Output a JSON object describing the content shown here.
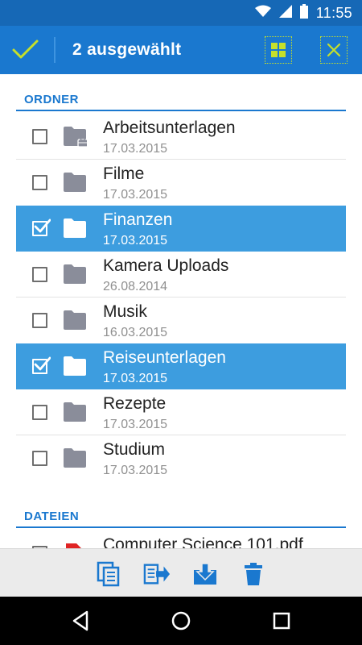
{
  "status_bar": {
    "time": "11:55"
  },
  "action_bar": {
    "title": "2 ausgewählt"
  },
  "sections": {
    "folders": "ORDNER",
    "files": "DATEIEN"
  },
  "folders": [
    {
      "name": "Arbeitsunterlagen",
      "date": "17.03.2015",
      "checked": false,
      "shared": true
    },
    {
      "name": "Filme",
      "date": "17.03.2015",
      "checked": false,
      "shared": false
    },
    {
      "name": "Finanzen",
      "date": "17.03.2015",
      "checked": true,
      "shared": false
    },
    {
      "name": "Kamera Uploads",
      "date": "26.08.2014",
      "checked": false,
      "shared": false
    },
    {
      "name": "Musik",
      "date": "16.03.2015",
      "checked": false,
      "shared": false
    },
    {
      "name": "Reiseunterlagen",
      "date": "17.03.2015",
      "checked": true,
      "shared": false
    },
    {
      "name": "Rezepte",
      "date": "17.03.2015",
      "checked": false,
      "shared": false
    },
    {
      "name": "Studium",
      "date": "17.03.2015",
      "checked": false,
      "shared": false
    }
  ],
  "files": [
    {
      "name": "Computer Science 101.pdf"
    }
  ],
  "icons": {
    "select_done": "check-icon",
    "select_all": "grid-icon",
    "cancel": "close-icon",
    "copy": "copy-icon",
    "move": "move-icon",
    "download": "download-icon",
    "delete": "trash-icon",
    "nav_back": "back-icon",
    "nav_home": "home-icon",
    "nav_recents": "recents-icon"
  },
  "colors": {
    "status_bar": "#1668b6",
    "action_bar": "#1a78cf",
    "accent_yellow": "#c6e02a",
    "selected_row": "#3d9ddf",
    "section_header": "#1a78cf",
    "folder_icon": "#8a8d9a",
    "toolbar_icon": "#1a78cf"
  }
}
